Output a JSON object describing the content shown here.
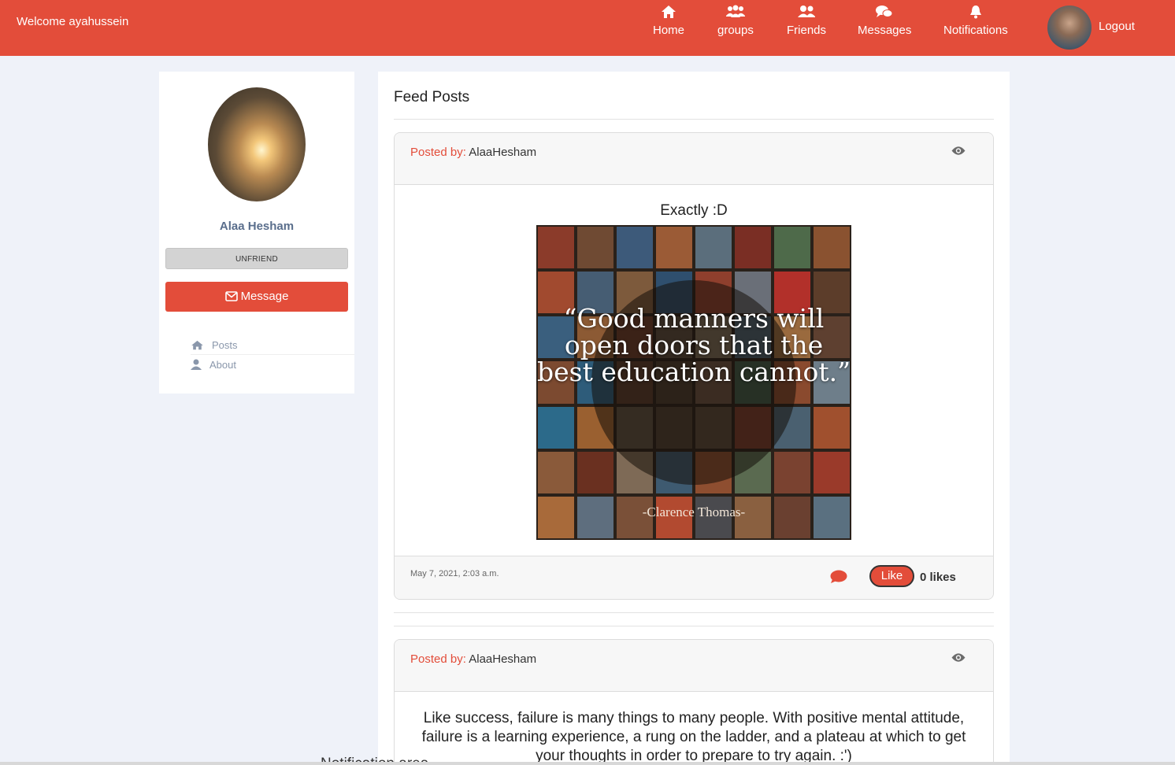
{
  "navbar": {
    "welcome": "Welcome ayahussein",
    "items": [
      {
        "label": "Home",
        "icon": "home-icon"
      },
      {
        "label": "groups",
        "icon": "users-icon"
      },
      {
        "label": "Friends",
        "icon": "user-friends-icon"
      },
      {
        "label": "Messages",
        "icon": "comments-icon"
      },
      {
        "label": "Notifications",
        "icon": "bell-icon"
      }
    ],
    "logout": "Logout",
    "accent_color": "#e34d3a"
  },
  "profile": {
    "name": "Alaa Hesham",
    "unfriend_label": "UNFRIEND",
    "message_label": "Message",
    "links": [
      {
        "label": "Posts",
        "icon": "home-icon"
      },
      {
        "label": "About",
        "icon": "user-icon"
      }
    ]
  },
  "feed": {
    "title": "Feed Posts",
    "posts": [
      {
        "posted_by_label": "Posted by:",
        "author": "AlaaHesham",
        "title": "Exactly :D",
        "image_quote": "“Good manners will open doors that the best education cannot.”",
        "image_author": "-Clarence Thomas-",
        "date": "May 7, 2021, 2:03 a.m.",
        "like_label": "Like",
        "likes": "0 likes"
      },
      {
        "posted_by_label": "Posted by:",
        "author": "AlaaHesham",
        "text": "Like success, failure is many things to many people. With positive mental attitude, failure is a learning experience, a rung on the ladder, and a plateau at which to get your thoughts in order to prepare to try again. :')"
      }
    ]
  },
  "overlap": {
    "text": "Notification area"
  }
}
